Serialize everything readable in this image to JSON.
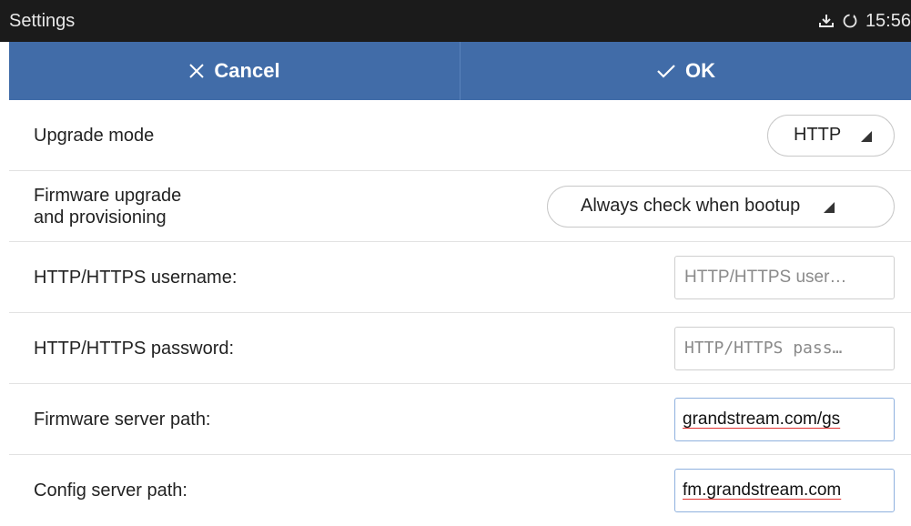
{
  "statusbar": {
    "title": "Settings",
    "time": "15:56",
    "icons": [
      "download-icon",
      "sync-icon"
    ]
  },
  "actionbar": {
    "cancel_label": "Cancel",
    "ok_label": "OK"
  },
  "rows": [
    {
      "label": "Upgrade mode",
      "type": "select",
      "value": "HTTP"
    },
    {
      "label_line1": "Firmware upgrade",
      "label_line2": "and provisioning",
      "type": "select",
      "value": "Always check when bootup"
    },
    {
      "label": "HTTP/HTTPS username:",
      "type": "input",
      "value": "",
      "placeholder": "HTTP/HTTPS user…"
    },
    {
      "label": "HTTP/HTTPS password:",
      "type": "input",
      "value": "",
      "placeholder": "HTTP/HTTPS pass…"
    },
    {
      "label": "Firmware server path:",
      "type": "input",
      "value": "grandstream.com/gs"
    },
    {
      "label": "Config server path:",
      "type": "input",
      "value": "fm.grandstream.com"
    }
  ],
  "colors": {
    "statusbar_bg": "#1b1b1b",
    "actionbar_bg": "#416ca8",
    "spellcheck_underline": "#e0302f"
  }
}
